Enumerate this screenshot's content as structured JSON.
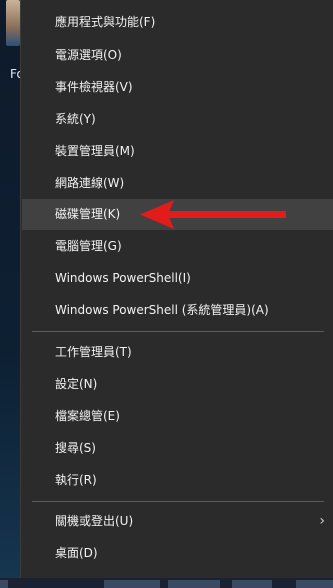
{
  "desktop": {
    "icon_label": "Fo"
  },
  "menu": {
    "items": [
      {
        "label": "應用程式與功能(F)"
      },
      {
        "label": "電源選項(O)"
      },
      {
        "label": "事件檢視器(V)"
      },
      {
        "label": "系統(Y)"
      },
      {
        "label": "裝置管理員(M)"
      },
      {
        "label": "網路連線(W)"
      },
      {
        "label": "磁碟管理(K)"
      },
      {
        "label": "電腦管理(G)"
      },
      {
        "label": "Windows PowerShell(I)"
      },
      {
        "label": "Windows PowerShell (系統管理員)(A)"
      },
      {
        "label": "工作管理員(T)"
      },
      {
        "label": "設定(N)"
      },
      {
        "label": "檔案總管(E)"
      },
      {
        "label": "搜尋(S)"
      },
      {
        "label": "執行(R)"
      },
      {
        "label": "關機或登出(U)"
      },
      {
        "label": "桌面(D)"
      }
    ],
    "highlighted_item": "磁碟管理(K)",
    "submenu_arrow": "›"
  },
  "colors": {
    "menu_background": "#2b2b2b",
    "hover_background": "#414141",
    "text": "#f2f2f2",
    "annotation_arrow": "#e21b1b"
  }
}
